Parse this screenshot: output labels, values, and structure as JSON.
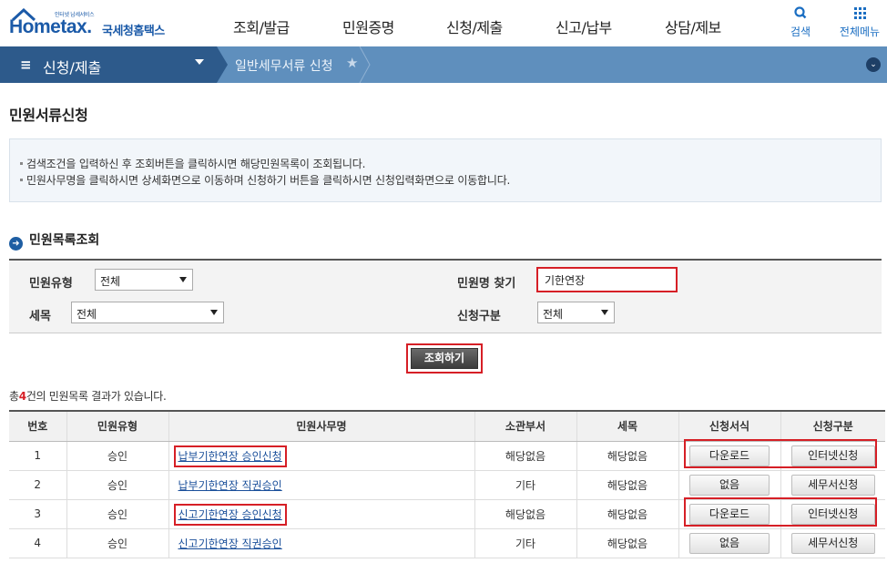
{
  "header": {
    "logo_tagline": "인터넷 납세서비스",
    "logo_word": "Hometax.",
    "logo_name": "국세청홈택스",
    "nav": [
      "조회/발급",
      "민원증명",
      "신청/제출",
      "신고/납부",
      "상담/제보"
    ],
    "search_label": "검색",
    "allmenu_label": "전체메뉴"
  },
  "navbar": {
    "section": "신청/제출",
    "crumb": "일반세무서류 신청"
  },
  "page": {
    "title": "민원서류신청",
    "info": [
      "검색조건을 입력하신 후 조회버튼을 클릭하시면 해당민원목록이 조회됩니다.",
      "민원사무명을 클릭하시면 상세화면으로 이동하며   신청하기 버튼을 클릭하시면 신청입력화면으로 이동합니다."
    ],
    "section_title": "민원목록조회"
  },
  "search": {
    "type_label": "민원유형",
    "type_value": "전체",
    "name_label": "민원명 찾기",
    "name_value": "기한연장",
    "tax_label": "세목",
    "tax_value": "전체",
    "apply_label": "신청구분",
    "apply_value": "전체",
    "button": "조회하기"
  },
  "result": {
    "prefix": "총",
    "count": "4",
    "suffix": "건의 민원목록 결과가 있습니다."
  },
  "table": {
    "headers": [
      "번호",
      "민원유형",
      "민원사무명",
      "소관부서",
      "세목",
      "신청서식",
      "신청구분"
    ],
    "rows": [
      {
        "no": "1",
        "type": "승인",
        "name": "납부기한연장 승인신청",
        "dept": "해당없음",
        "tax": "해당없음",
        "form": "다운로드",
        "apply": "인터넷신청"
      },
      {
        "no": "2",
        "type": "승인",
        "name": "납부기한연장 직권승인",
        "dept": "기타",
        "tax": "해당없음",
        "form": "없음",
        "apply": "세무서신청"
      },
      {
        "no": "3",
        "type": "승인",
        "name": "신고기한연장 승인신청",
        "dept": "해당없음",
        "tax": "해당없음",
        "form": "다운로드",
        "apply": "인터넷신청"
      },
      {
        "no": "4",
        "type": "승인",
        "name": "신고기한연장 직권승인",
        "dept": "기타",
        "tax": "해당없음",
        "form": "없음",
        "apply": "세무서신청"
      }
    ]
  },
  "colors": {
    "brand": "#1b5aa8",
    "navbar_dark": "#2d5a8b",
    "navbar_light": "#5f8fbd",
    "highlight": "#d61f26"
  }
}
